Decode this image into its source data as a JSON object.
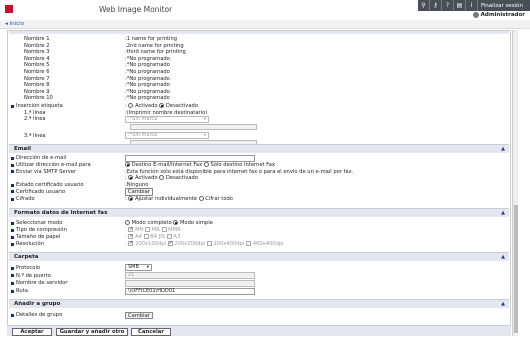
{
  "header": {
    "app_title": "Web Image Monitor",
    "logout_label": "Finalizar sesión",
    "user_label": "Administrador",
    "home_link": "Inicio",
    "icons": [
      "search-icon",
      "key-icon",
      "question-icon",
      "print-icon",
      "info-icon"
    ]
  },
  "names": [
    {
      "label": "Nombre 1",
      "value": ":1 name for printing"
    },
    {
      "label": "Nombre 2",
      "value": ":2nd name for printing"
    },
    {
      "label": "Nombre 3",
      "value": ":third name for printing"
    },
    {
      "label": "Nombre 4",
      "value": ":*No programado"
    },
    {
      "label": "Nombre 5",
      "value": ":*No programado"
    },
    {
      "label": "Nombre 6",
      "value": ":*No programado"
    },
    {
      "label": "Nombre 7",
      "value": ":*No programado"
    },
    {
      "label": "Nombre 8",
      "value": ":*No programado"
    },
    {
      "label": "Nombre 9",
      "value": ":*No programado"
    },
    {
      "label": "Nombre 10",
      "value": ":*No programado"
    }
  ],
  "etiqueta": {
    "label": "Inserción etiqueta",
    "activado": "Activado",
    "desactivado": "Desactivado",
    "linea1_label": "1.ª línea",
    "linea1_value": ":(Imprimir nombre destinatario)",
    "linea2_label": "2.ª línea",
    "linea2_select": ":*Sin marca",
    "linea3_label": "3.ª línea",
    "linea3_select": ":*Sin marca"
  },
  "email": {
    "section": "Email",
    "direccion_label": "Dirección de e-mail",
    "utilizar_label": "Utilizar dirección e-mail para",
    "destino_fax": "Destino E-mail/Internet Fax",
    "solo_internet": "Sólo destino Internet Fax",
    "smtp_label": "Enviar vía SMTP Server",
    "smtp_note": ":Esta función sólo está disponible para internet fax o para el envío de un e-mail por fax.",
    "activado": "Activado",
    "desactivado": "Desactivado",
    "estado_label": "Estado certificado usuario",
    "estado_value": ":Ninguno",
    "cert_label": "Certificado usuario",
    "cert_button": "Cambiar",
    "cifrado_label": "Cifrado",
    "ajustar": "Ajustar individualmente",
    "cifrar": "Cifrar todo"
  },
  "fax": {
    "section": "Formato datos de Internet fax",
    "modo_label": "Seleccionar modo",
    "modo_completo": "Modo completo",
    "modo_simple": "Modo simple",
    "compresion_label": "Tipo de compresión",
    "compresion": [
      "MH",
      "MR",
      "MMR"
    ],
    "papel_label": "Tamaño de papel",
    "papel": [
      "A4",
      "B4 JIS",
      "A3"
    ],
    "resolucion_label": "Resolución",
    "resolucion": [
      "200x100dpi",
      "200x200dpi",
      "200x400dpi",
      "400x400dpi"
    ]
  },
  "carpeta": {
    "section": "Carpeta",
    "protocolo_label": "Protocolo",
    "protocolo_value": "SMB",
    "puerto_label": "N.º de puerto",
    "puerto_value": "21",
    "servidor_label": "Nombre de servidor",
    "ruta_label": "Ruta",
    "ruta_value": "\\\\OFFICE01\\HDD01"
  },
  "grupo": {
    "section": "Añadir a grupo",
    "detalles_label": "Detalles de grupo",
    "detalles_button": "Cambiar"
  },
  "footer": {
    "aceptar": "Aceptar",
    "guardar": "Guardar y añadir otro",
    "cancelar": "Cancelar"
  },
  "colors": {
    "section_bg": "#e4e7ef",
    "bullet": "#1a2a6c",
    "topbar": "#4a4f57",
    "logo": "#c8102e"
  }
}
